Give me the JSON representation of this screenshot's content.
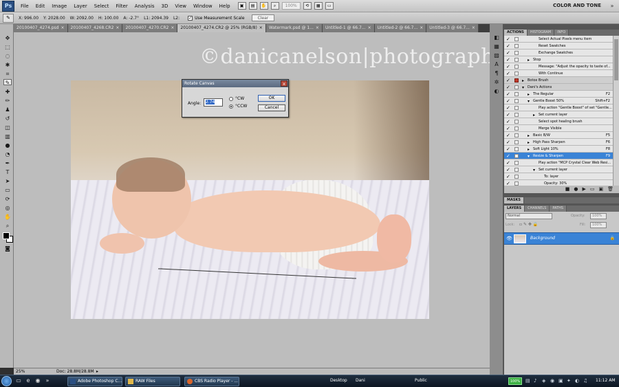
{
  "app": {
    "logo": "Ps"
  },
  "menu": [
    "File",
    "Edit",
    "Image",
    "Layer",
    "Select",
    "Filter",
    "Analysis",
    "3D",
    "View",
    "Window",
    "Help"
  ],
  "menubar": {
    "zoom": "100%",
    "workspace": "COLOR AND TONE",
    "workspace_arrow": "»"
  },
  "options": {
    "x": "X: 996.00",
    "y": "Y: 2028.00",
    "w": "W: 2092.00",
    "h": "H: 100.00",
    "a": "A: -2.7°",
    "l1": "L1: 2094.39",
    "l2": "L2:",
    "use_measurement_scale": "Use Measurement Scale",
    "clear": "Clear"
  },
  "tabs": [
    "20100407_4274.psd",
    "20100407_4268.CR2",
    "20100407_4270.CR2",
    "20100407_4274.CR2 @ 25% (RGB/8)",
    "Watermark.psd @ 1...",
    "Untitled-1 @ 66.7...",
    "Untitled-2 @ 66.7...",
    "Untitled-3 @ 66.7..."
  ],
  "tab_close": "×",
  "watermark": "©danicanelson|photography",
  "dialog": {
    "title": "Rotate Canvas",
    "close": "x",
    "angle_label": "Angle:",
    "angle_value": "2.74",
    "cw_label": "°CW",
    "ccw_label": "°CCW",
    "ok": "OK",
    "cancel": "Cancel"
  },
  "status": {
    "zoom": "25%",
    "doc": "Doc: 28.8M/28.8M",
    "arrow": "▸"
  },
  "panels": {
    "actions_tabs": [
      "ACTIONS",
      "HISTOGRAM",
      "INFO"
    ],
    "masks_tab": "MASKS",
    "layers_tabs": [
      "LAYERS",
      "CHANNELS",
      "PATHS"
    ],
    "blend_mode": "Normal",
    "opacity_label": "Opacity:",
    "opacity_value": "100%",
    "lock_label": "Lock:",
    "fill_label": "Fill:",
    "fill_value": "100%",
    "layer_name": "Background"
  },
  "actions": [
    {
      "label": "Select Actual Pixels menu item",
      "indent": 3,
      "key": ""
    },
    {
      "label": "Reset Swatches",
      "indent": 3,
      "key": ""
    },
    {
      "label": "Exchange Swatches",
      "indent": 3,
      "key": ""
    },
    {
      "label": "Stop",
      "indent": 2,
      "key": "",
      "tri": "▸"
    },
    {
      "label": "Message: \"Adjust the opacity to taste of...",
      "indent": 3,
      "key": ""
    },
    {
      "label": "With Continue",
      "indent": 3,
      "key": ""
    },
    {
      "label": "Botox Brush",
      "indent": 1,
      "key": "",
      "set": true,
      "tri": "▸"
    },
    {
      "label": "Dani's Actions",
      "indent": 1,
      "key": "",
      "set": true,
      "tri": "▾"
    },
    {
      "label": "The Regular",
      "indent": 2,
      "key": "F2",
      "tri": "▸"
    },
    {
      "label": "Gentle Boost 50%",
      "indent": 2,
      "key": "Shift+F2",
      "tri": "▾"
    },
    {
      "label": "Play action \"Gentle Boost\" of set \"Gentle...",
      "indent": 3,
      "key": ""
    },
    {
      "label": "Set current layer",
      "indent": 3,
      "key": "",
      "tri": "▸"
    },
    {
      "label": "Select spot healing brush",
      "indent": 3,
      "key": ""
    },
    {
      "label": "Merge Visible",
      "indent": 3,
      "key": ""
    },
    {
      "label": "Basic B/W",
      "indent": 2,
      "key": "F5",
      "tri": "▸"
    },
    {
      "label": "High Pass Sharpen",
      "indent": 2,
      "key": "F6",
      "tri": "▸"
    },
    {
      "label": "Soft Light 10%",
      "indent": 2,
      "key": "F8",
      "tri": "▸"
    },
    {
      "label": "Resize & Sharpen",
      "indent": 2,
      "key": "F9",
      "selected": true,
      "tri": "▾"
    },
    {
      "label": "Play action \"MCP Crystal Clear Web Resi...",
      "indent": 3,
      "key": ""
    },
    {
      "label": "Set current layer",
      "indent": 3,
      "key": "",
      "tri": "▾"
    },
    {
      "label": "To: layer",
      "indent": 4,
      "key": ""
    },
    {
      "label": "Opacity: 30%",
      "indent": 4,
      "key": ""
    }
  ],
  "actions_buttons": [
    "■",
    "●",
    "▶",
    "▭",
    "▣",
    "🗑"
  ],
  "taskbar": {
    "items": [
      "Adobe Photoshop C...",
      "RAW Files",
      "CBS Radio Player - ..."
    ],
    "desktop": "Desktop",
    "dani": "Dani",
    "public": "Public",
    "battery": "100%",
    "time": "11:12 AM"
  }
}
